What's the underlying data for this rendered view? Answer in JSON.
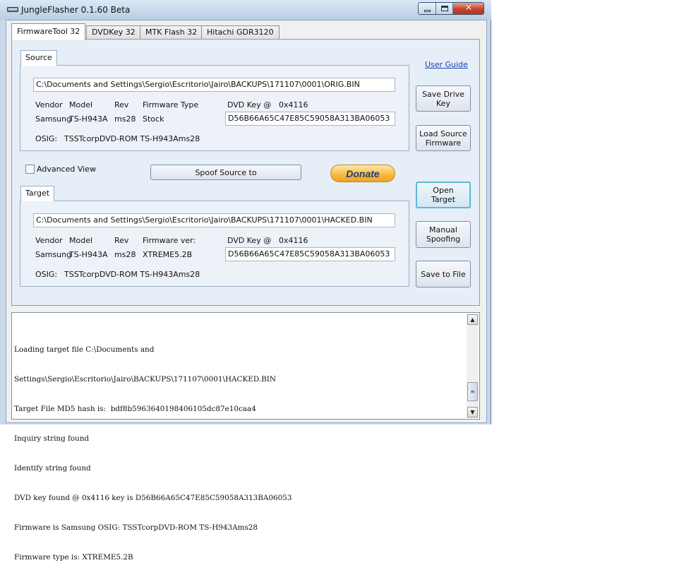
{
  "window": {
    "title": "JungleFlasher 0.1.60 Beta",
    "caption": {
      "close_glyph": "✕"
    }
  },
  "tabs": [
    {
      "label": "FirmwareTool 32"
    },
    {
      "label": "DVDKey 32"
    },
    {
      "label": "MTK Flash 32"
    },
    {
      "label": "Hitachi GDR3120"
    }
  ],
  "source": {
    "group_label": "Source",
    "path": "C:\\Documents and Settings\\Sergio\\Escritorio\\Jairo\\BACKUPS\\171107\\0001\\ORIG.BIN",
    "headers": {
      "vendor": "Vendor",
      "model": "Model",
      "rev": "Rev",
      "fw": "Firmware Type",
      "dvdkey": "DVD Key @",
      "offset": "0x4116"
    },
    "vendor": "Samsung",
    "model": "TS-H943A",
    "rev": "ms28",
    "fw": "Stock",
    "dvdkey_value": "D56B66A65C47E85C59058A313BA06053",
    "osig_label": "OSIG:",
    "osig_value": "TSSTcorpDVD-ROM TS-H943Ams28"
  },
  "target": {
    "group_label": "Target",
    "path": "C:\\Documents and Settings\\Sergio\\Escritorio\\Jairo\\BACKUPS\\171107\\0001\\HACKED.BIN",
    "headers": {
      "vendor": "Vendor",
      "model": "Model",
      "rev": "Rev",
      "fw": "Firmware ver:",
      "dvdkey": "DVD Key @",
      "offset": "0x4116"
    },
    "vendor": "Samsung",
    "model": "TS-H943A",
    "rev": "ms28",
    "fw": "XTREME5.2B",
    "dvdkey_value": "D56B66A65C47E85C59058A313BA06053",
    "osig_label": "OSIG:",
    "osig_value": "TSSTcorpDVD-ROM TS-H943Ams28"
  },
  "controls": {
    "advanced_view": "Advanced View",
    "advanced_checked": false,
    "spoof": "Spoof Source to",
    "donate": "Donate",
    "user_guide": "User Guide",
    "save_drive_key": "Save Drive Key",
    "load_source_1": "Load Source",
    "load_source_2": "Firmware",
    "open_target_1": "Open",
    "open_target_2": "Target",
    "manual_spoof_1": "Manual",
    "manual_spoof_2": "Spoofing",
    "save_to_file": "Save to File"
  },
  "log": {
    "lines": [
      "Loading target file C:\\Documents and",
      "Settings\\Sergio\\Escritorio\\Jairo\\BACKUPS\\171107\\0001\\HACKED.BIN",
      "Target File MD5 hash is:  bdf8b5963640198406105dc87e10caa4",
      "Inquiry string found",
      "Identify string found",
      "DVD key found @ 0x4116 key is D56B66A65C47E85C59058A313BA06053",
      "Firmware is Samsung OSIG: TSSTcorpDVD-ROM TS-H943Ams28",
      "Firmware type is: XTREME5.2B"
    ]
  }
}
